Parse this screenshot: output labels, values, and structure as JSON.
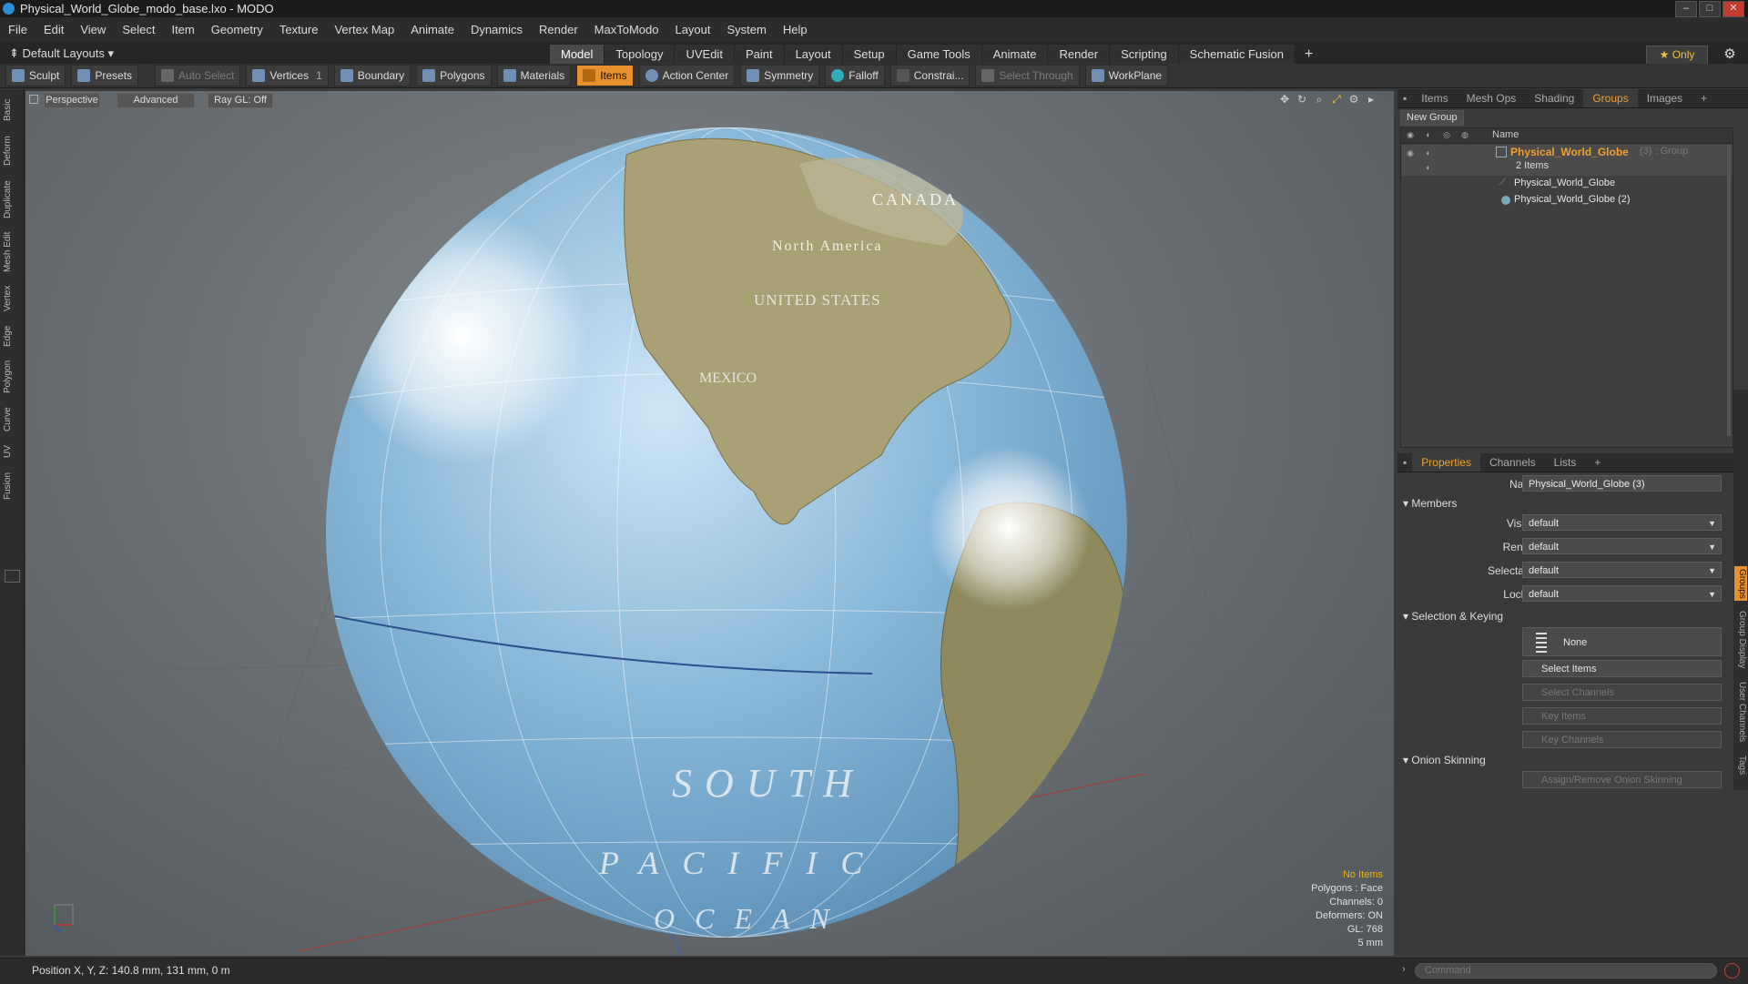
{
  "window": {
    "title": "Physical_World_Globe_modo_base.lxo - MODO"
  },
  "menu": [
    "File",
    "Edit",
    "View",
    "Select",
    "Item",
    "Geometry",
    "Texture",
    "Vertex Map",
    "Animate",
    "Dynamics",
    "Render",
    "MaxToModo",
    "Layout",
    "System",
    "Help"
  ],
  "layout": {
    "default_layouts": "Default Layouts",
    "tabs": [
      "Model",
      "Topology",
      "UVEdit",
      "Paint",
      "Layout",
      "Setup",
      "Game Tools",
      "Animate",
      "Render",
      "Scripting",
      "Schematic Fusion"
    ],
    "active_tab": "Model",
    "plus": "+",
    "only_label": "Only"
  },
  "toolbar": {
    "sculpt": "Sculpt",
    "presets": "Presets",
    "auto_select": "Auto Select",
    "vertices": "Vertices",
    "vertices_count": "1",
    "boundary": "Boundary",
    "polygons": "Polygons",
    "materials": "Materials",
    "items": "Items",
    "action_center": "Action Center",
    "symmetry": "Symmetry",
    "falloff": "Falloff",
    "constraints": "Constrai...",
    "select_through": "Select Through",
    "workplane": "WorkPlane"
  },
  "left_dock": [
    "Basic",
    "Deform",
    "Duplicate",
    "Mesh Edit",
    "Vertex",
    "Edge",
    "Polygon",
    "Curve",
    "UV",
    "Fusion"
  ],
  "viewport": {
    "view_mode": "Perspective",
    "advanced": "Advanced",
    "raygl": "Ray GL: Off",
    "globe_labels": {
      "canada": "CANADA",
      "north_america": "North America",
      "united_states": "UNITED STATES",
      "mexico": "MEXICO",
      "south": "SOUTH",
      "pacific": "PACIFIC",
      "ocean": "OCEAN"
    },
    "info": {
      "selection": "No Items",
      "polygons": "Polygons : Face",
      "channels": "Channels: 0",
      "deformers": "Deformers: ON",
      "gl": "GL: 768",
      "units": "5 mm"
    }
  },
  "status": {
    "position": "Position X, Y, Z:   140.8 mm, 131 mm, 0 m",
    "command_placeholder": "Command"
  },
  "items_panel": {
    "tabs": [
      "Items",
      "Mesh Ops",
      "Shading",
      "Groups",
      "Images"
    ],
    "active_tab": "Groups",
    "new_group": "New Group",
    "col_name": "Name",
    "group_name": "Physical_World_Globe",
    "group_suffix": "(3) : Group",
    "group_count": "2 Items",
    "children": [
      "Physical_World_Globe",
      "Physical_World_Globe (2)"
    ]
  },
  "properties": {
    "tabs": [
      "Properties",
      "Channels",
      "Lists"
    ],
    "active_tab": "Properties",
    "name_label": "Name",
    "name_value": "Physical_World_Globe (3)",
    "members_section": "Members",
    "visible_label": "Visible",
    "visible_value": "default",
    "render_label": "Render",
    "render_value": "default",
    "selectable_label": "Selectable",
    "selectable_value": "default",
    "locked_label": "Locked",
    "locked_value": "default",
    "selection_section": "Selection & Keying",
    "none_btn": "None",
    "select_items": "Select Items",
    "select_channels": "Select Channels",
    "key_items": "Key Items",
    "key_channels": "Key Channels",
    "onion_section": "Onion Skinning",
    "assign_onion": "Assign/Remove Onion Skinning",
    "side_tabs": [
      "Groups",
      "Group Display",
      "User Channels",
      "Tags"
    ]
  },
  "colors": {
    "accent": "#e8912d",
    "warning": "#f0b400"
  }
}
